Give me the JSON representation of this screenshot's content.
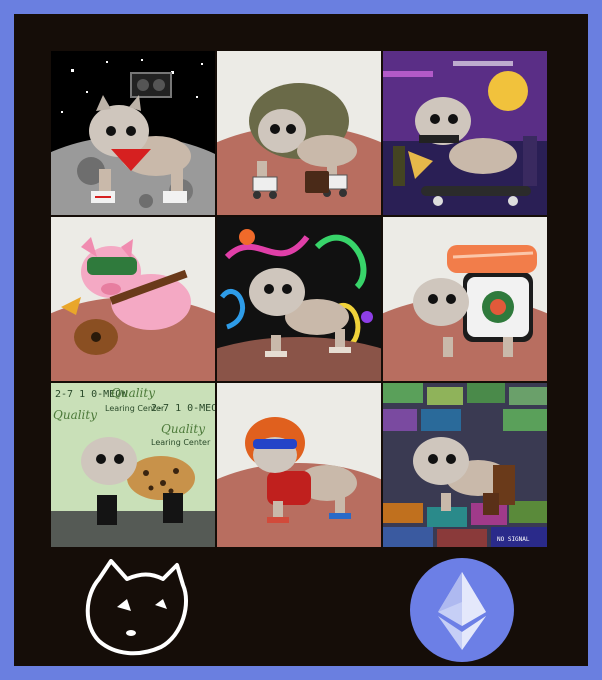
{
  "tiles": [
    {
      "id": "moon-cat"
    },
    {
      "id": "hoodie-cat"
    },
    {
      "id": "skateboard-cat"
    },
    {
      "id": "pig-guitar-cat"
    },
    {
      "id": "graffiti-cat"
    },
    {
      "id": "sushi-cat"
    },
    {
      "id": "leopard-coat-cat"
    },
    {
      "id": "red-wig-cat"
    },
    {
      "id": "money-cat"
    }
  ],
  "signs": {
    "meow_phone": "2-7 1 0-MEOW",
    "quality": "Quality",
    "learning_center": "Learing Center",
    "no_signal": "NO SIGNAL"
  },
  "colors": {
    "border": "#6a7fe0",
    "frame": "#150d08",
    "eth_circle": "#6c7fe6"
  },
  "icons": [
    "cat-face-logo-icon",
    "ethereum-logo-icon"
  ]
}
